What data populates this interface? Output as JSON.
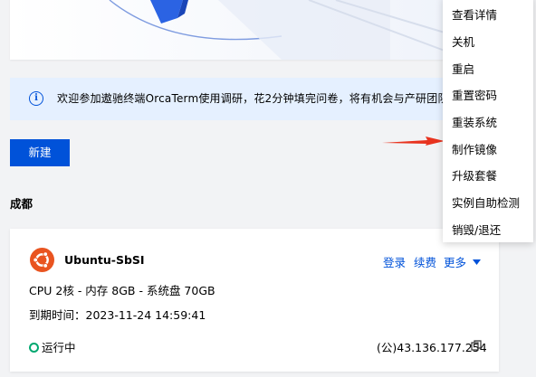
{
  "notice": {
    "text": "欢迎参加遨驰终端OrcaTerm使用调研，花2分钟填完问卷，将有机会与产研团队直接沟通",
    "icon": "info-icon"
  },
  "create_button": "新建",
  "region": "成都",
  "instance": {
    "name": "Ubuntu-SbSI",
    "spec": "CPU 2核 - 内存 8GB - 系统盘 70GB",
    "expiry_label": "到期时间：",
    "expiry": "2023-11-24 14:59:41",
    "status": "运行中",
    "ip": "(公)43.136.177.254",
    "actions": {
      "login": "登录",
      "renew": "续费",
      "more": "更多"
    },
    "os_icon": "ubuntu-icon"
  },
  "menu": {
    "items": [
      "查看详情",
      "关机",
      "重启",
      "重置密码",
      "重装系统",
      "制作镜像",
      "升级套餐",
      "实例自助检测",
      "销毁/退还"
    ]
  },
  "colors": {
    "primary": "#0052d9",
    "notice_bg": "#e5f0ff",
    "success": "#00a870",
    "ubuntu": "#e95420",
    "arrow": "#e8331f"
  }
}
